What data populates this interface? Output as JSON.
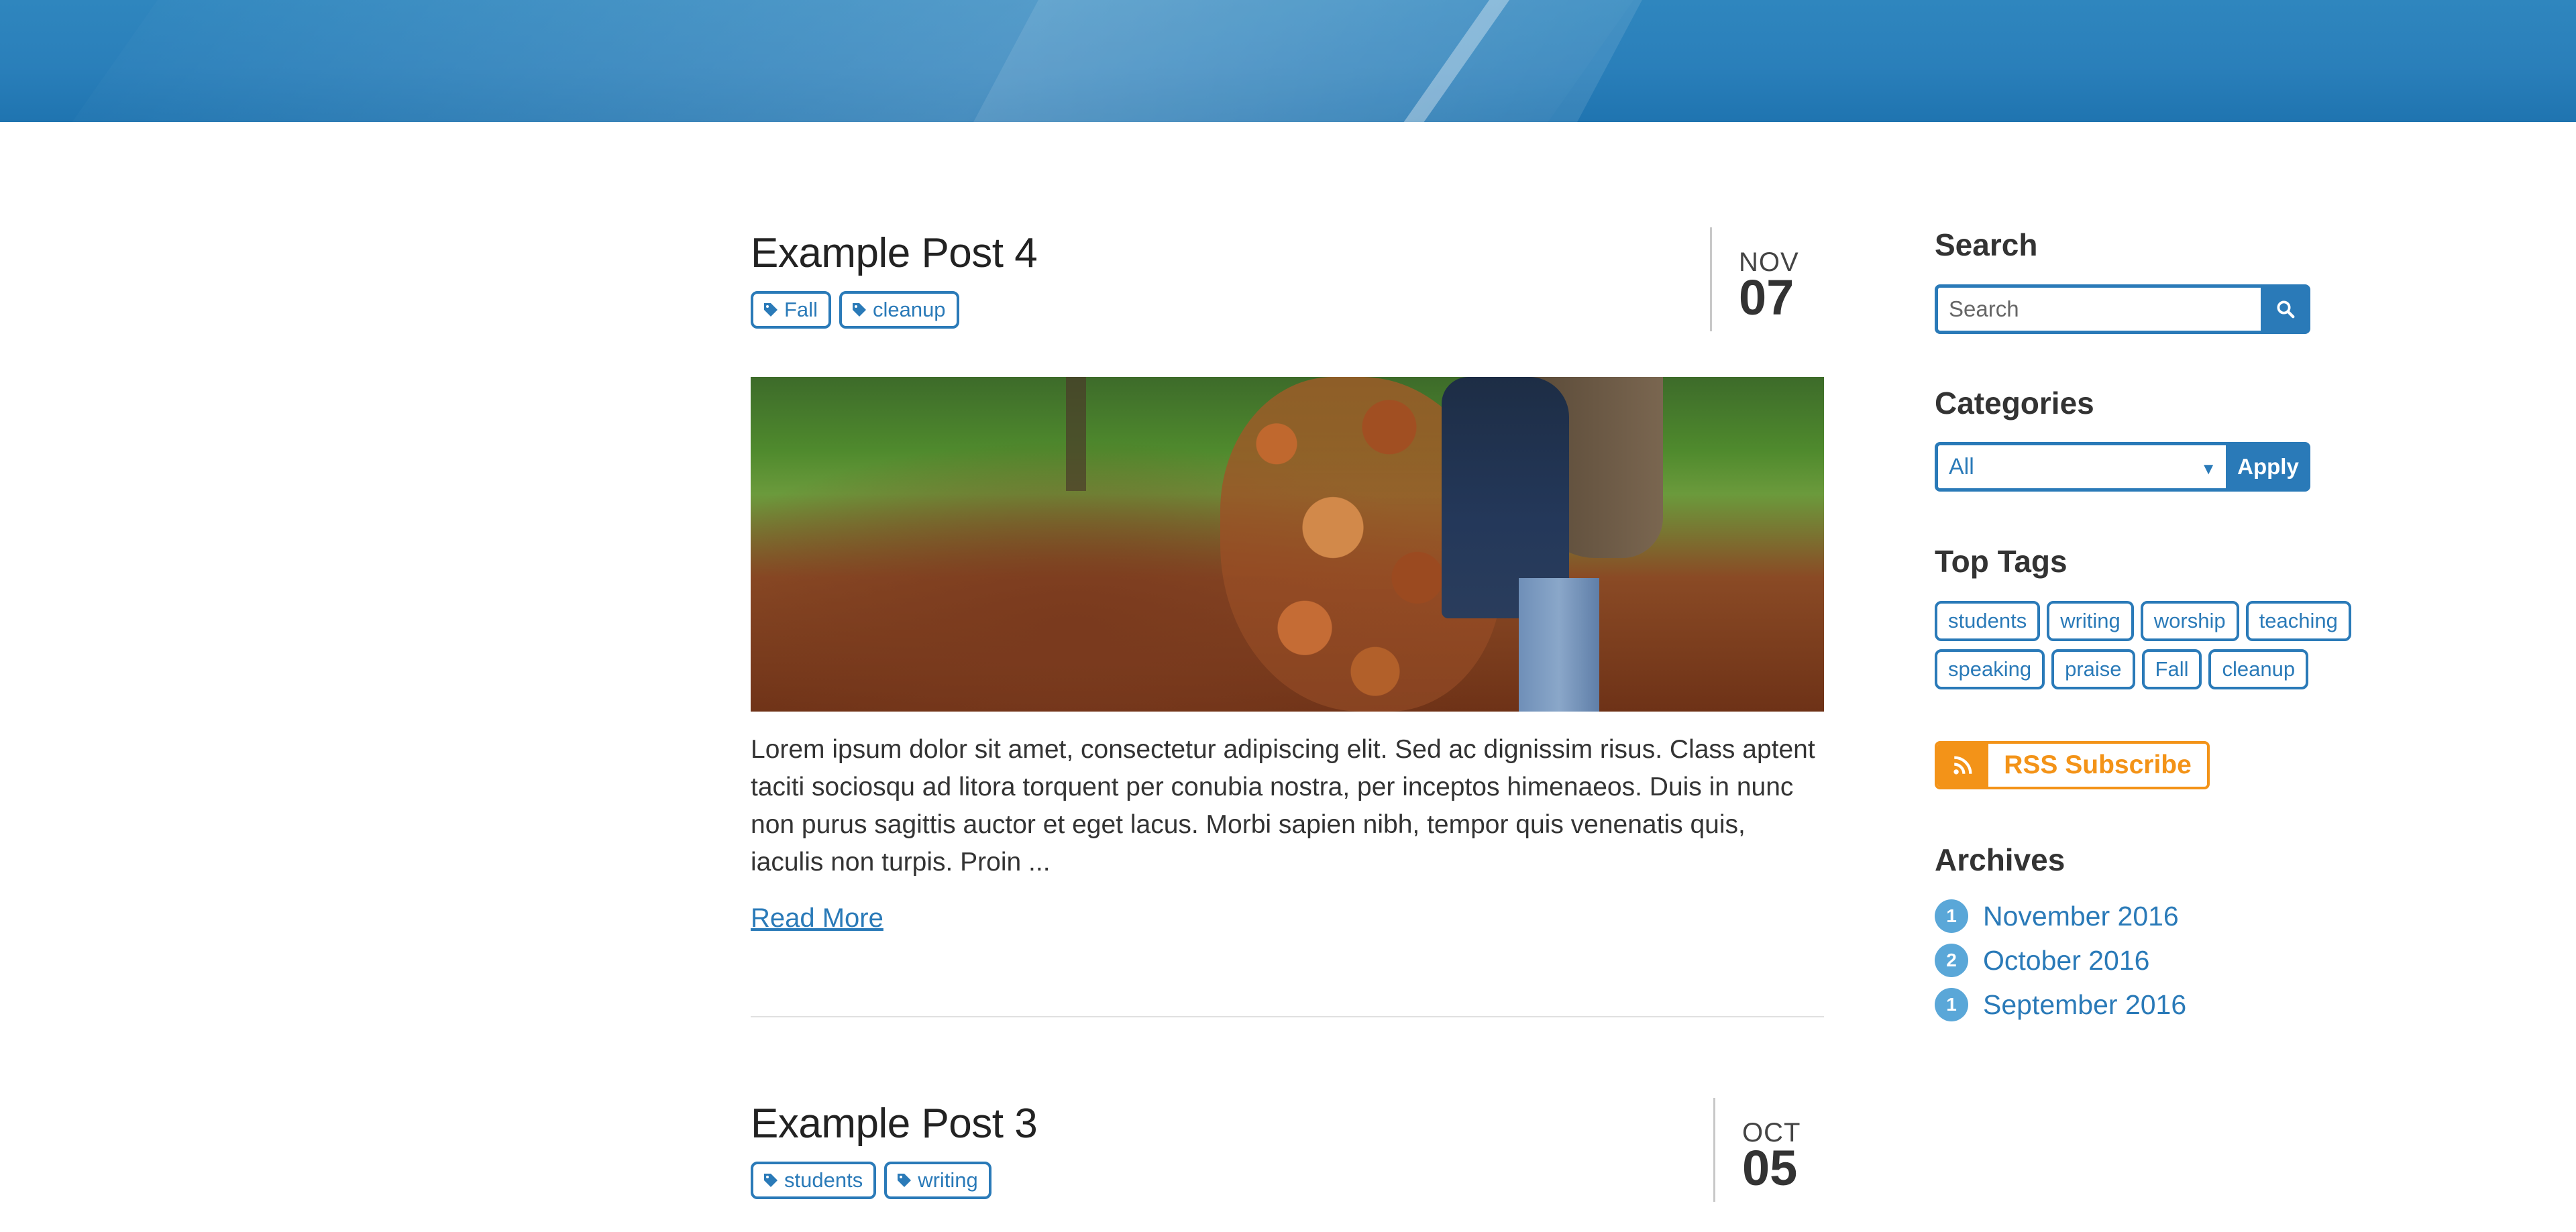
{
  "posts": [
    {
      "title": "Example Post 4",
      "tags": [
        "Fall",
        "cleanup"
      ],
      "month": "NOV",
      "day": "07",
      "excerpt": "Lorem ipsum dolor sit amet, consectetur adipiscing elit. Sed ac dignissim risus. Class aptent taciti sociosqu ad litora torquent per conubia nostra, per inceptos himenaeos. Duis in nunc non purus sagittis auctor et eget lacus. Morbi sapien nibh, tempor quis venenatis quis, iaculis non turpis. Proin ...",
      "read_more": "Read More"
    },
    {
      "title": "Example Post 3",
      "tags": [
        "students",
        "writing"
      ],
      "month": "OCT",
      "day": "05"
    }
  ],
  "sidebar": {
    "search": {
      "title": "Search",
      "placeholder": "Search",
      "button_icon": "search-icon"
    },
    "categories": {
      "title": "Categories",
      "selected": "All",
      "apply_label": "Apply"
    },
    "top_tags": {
      "title": "Top Tags",
      "tags": [
        "students",
        "writing",
        "worship",
        "teaching",
        "speaking",
        "praise",
        "Fall",
        "cleanup"
      ]
    },
    "rss": {
      "label": "RSS Subscribe",
      "icon": "rss-icon",
      "color": "#f39318"
    },
    "archives": {
      "title": "Archives",
      "items": [
        {
          "count": "1",
          "label": "November 2016"
        },
        {
          "count": "2",
          "label": "October 2016"
        },
        {
          "count": "1",
          "label": "September 2016"
        }
      ]
    }
  },
  "colors": {
    "accent": "#2a7ab8",
    "hero": "#2f86be",
    "rss": "#f39318",
    "badge": "#5aa7d8"
  }
}
